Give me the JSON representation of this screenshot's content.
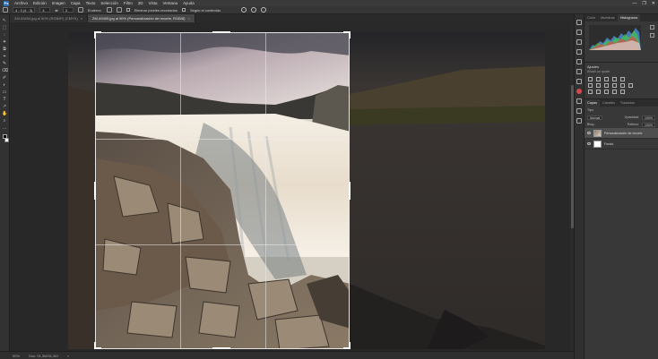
{
  "app": {
    "logo": "Ps",
    "menu": [
      "Archivo",
      "Edición",
      "Imagen",
      "Capa",
      "Texto",
      "Selección",
      "Filtro",
      "3D",
      "Vista",
      "Ventana",
      "Ayuda"
    ],
    "window_controls": [
      "—",
      "❐",
      "✕"
    ]
  },
  "options": {
    "ratio": "4 : 3 (4 : 3)",
    "width": "4",
    "height": "3",
    "straighten": "Enderez.",
    "delete_pixels": "Eliminar píxeles recortados",
    "content_aware": "Según el contenido"
  },
  "tabs": [
    {
      "label": "ZM-53494.jpg al 50% (RGB/8*) (CMYK)",
      "active": false
    },
    {
      "label": "ZM-49400.jpg al 50% (Personalización de recorte, RGB/8)",
      "active": true
    }
  ],
  "tools": [
    "↖",
    "⬚",
    "◌",
    "✦",
    "⧉",
    "⌖",
    "✎",
    "⌫",
    "✐",
    "◐",
    "▭",
    "T",
    "↗",
    "✋",
    "⌕",
    "…"
  ],
  "status": {
    "zoom": "50%",
    "doc": "Doc: 91,3M/91,3M",
    "arrow": ">"
  },
  "panels": {
    "top_tabs": [
      "Color",
      "Muestras",
      "Histograma"
    ],
    "adjustments": {
      "title": "Ajustes",
      "subtitle": "Añadir un ajuste"
    },
    "layer_tabs": [
      "Capas",
      "Canales",
      "Trazados"
    ],
    "kind": "Tipo",
    "blend": "Normal",
    "opacity_label": "Opacidad:",
    "opacity": "100%",
    "lock_label": "Bloq.:",
    "fill_label": "Relleno:",
    "fill": "100%",
    "layers": [
      {
        "name": "Personalización de recorte",
        "selected": true,
        "thumb": "photo"
      },
      {
        "name": "Fondo",
        "selected": false,
        "thumb": "white"
      }
    ]
  },
  "colors": {
    "accent": "#2b6fb7",
    "crop_border": "#e6e6e6",
    "panel_bg": "#383838",
    "app_bg": "#282828"
  }
}
